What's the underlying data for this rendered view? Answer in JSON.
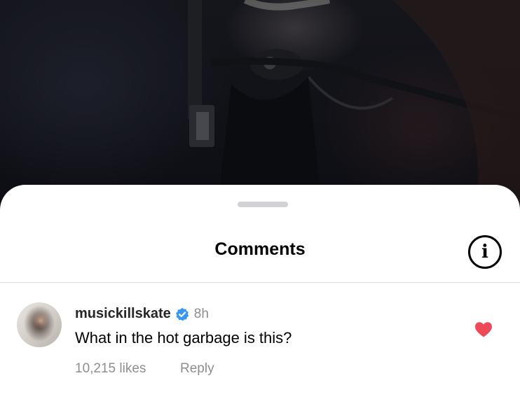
{
  "sheet": {
    "title": "Comments"
  },
  "comments": [
    {
      "username": "musickillskate",
      "verified": true,
      "time": "8h",
      "text": "What in the hot garbage is this?",
      "likes": "10,215 likes",
      "reply_label": "Reply",
      "liked": true
    }
  ],
  "colors": {
    "heart": "#ed4956",
    "verified_badge": "#3897f0",
    "secondary_text": "#8e8e8e"
  },
  "icons": {
    "info": "info-circle-icon",
    "verified": "verified-badge-icon",
    "like": "heart-filled-icon"
  }
}
